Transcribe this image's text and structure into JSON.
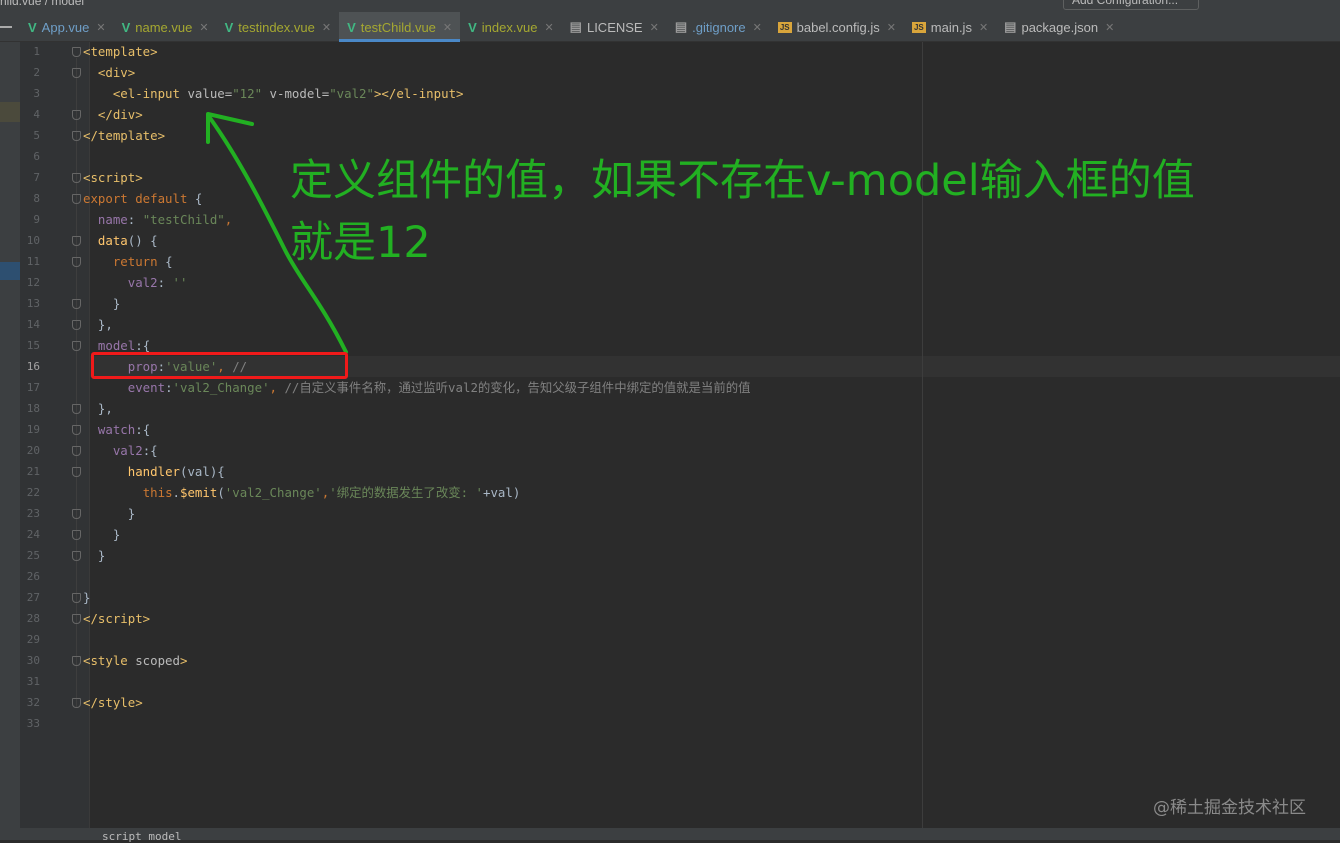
{
  "breadcrumb": "hild.vue / model",
  "run_config": "Add Configuration...",
  "tabs": [
    {
      "label": "App.vue",
      "icon": "V",
      "color": "#6f9fc8",
      "iconColor": "#41b883"
    },
    {
      "label": "name.vue",
      "icon": "V",
      "color": "#a5a831",
      "iconColor": "#41b883"
    },
    {
      "label": "testindex.vue",
      "icon": "V",
      "color": "#a5a831",
      "iconColor": "#41b883"
    },
    {
      "label": "testChild.vue",
      "icon": "V",
      "color": "#a5a831",
      "iconColor": "#41b883",
      "active": true
    },
    {
      "label": "index.vue",
      "icon": "V",
      "color": "#a5a831",
      "iconColor": "#41b883"
    },
    {
      "label": "LICENSE",
      "icon": "▤",
      "color": "#bbbbbb",
      "iconColor": "#999999"
    },
    {
      "label": ".gitignore",
      "icon": "▤",
      "color": "#6f9fc8",
      "iconColor": "#999999"
    },
    {
      "label": "babel.config.js",
      "icon": "JS",
      "color": "#bbbbbb",
      "iconColor": "#d9a53b"
    },
    {
      "label": "main.js",
      "icon": "JS",
      "color": "#bbbbbb",
      "iconColor": "#d9a53b"
    },
    {
      "label": "package.json",
      "icon": "▤",
      "color": "#bbbbbb",
      "iconColor": "#999999"
    }
  ],
  "current_line": 16,
  "code": [
    [
      [
        "<template>",
        "tag"
      ]
    ],
    [
      [
        "  "
      ],
      [
        "<div>",
        "tag"
      ]
    ],
    [
      [
        "    "
      ],
      [
        "<el-input ",
        "tag"
      ],
      [
        "value=",
        "attr"
      ],
      [
        "\"12\"",
        "str"
      ],
      [
        " v-model=",
        "attr"
      ],
      [
        "\"val2\"",
        "str"
      ],
      [
        "></el-input>",
        "tag"
      ]
    ],
    [
      [
        "  "
      ],
      [
        "</div>",
        "tag"
      ]
    ],
    [
      [
        "</template>",
        "tag"
      ]
    ],
    [],
    [
      [
        "<script>",
        "tag"
      ]
    ],
    [
      [
        "export default ",
        "kw"
      ],
      [
        "{"
      ]
    ],
    [
      [
        "  "
      ],
      [
        "name",
        "prop"
      ],
      [
        ": "
      ],
      [
        "\"testChild\"",
        "str"
      ],
      [
        ",",
        "kw"
      ]
    ],
    [
      [
        "  "
      ],
      [
        "data",
        "fn"
      ],
      [
        "() {"
      ]
    ],
    [
      [
        "    "
      ],
      [
        "return ",
        "kw"
      ],
      [
        "{"
      ]
    ],
    [
      [
        "      "
      ],
      [
        "val2",
        "prop"
      ],
      [
        ": "
      ],
      [
        "''",
        "str"
      ]
    ],
    [
      [
        "    }"
      ]
    ],
    [
      [
        "  },"
      ]
    ],
    [
      [
        "  "
      ],
      [
        "model",
        "prop"
      ],
      [
        ":{"
      ]
    ],
    [
      [
        "      "
      ],
      [
        "prop",
        "prop"
      ],
      [
        ":"
      ],
      [
        "'value'",
        "str"
      ],
      [
        ", ",
        "kw"
      ],
      [
        "//",
        "cm"
      ]
    ],
    [
      [
        "      "
      ],
      [
        "event",
        "prop"
      ],
      [
        ":"
      ],
      [
        "'val2_Change'",
        "str"
      ],
      [
        ", ",
        "kw"
      ],
      [
        "//自定义事件名称，通过监听val2的变化，告知父级子组件中绑定的值就是当前的值",
        "cm"
      ]
    ],
    [
      [
        "  },"
      ]
    ],
    [
      [
        "  "
      ],
      [
        "watch",
        "prop"
      ],
      [
        ":{"
      ]
    ],
    [
      [
        "    "
      ],
      [
        "val2",
        "prop"
      ],
      [
        ":{"
      ]
    ],
    [
      [
        "      "
      ],
      [
        "handler",
        "fn"
      ],
      [
        "(val){"
      ]
    ],
    [
      [
        "        "
      ],
      [
        "this",
        "kw"
      ],
      [
        "."
      ],
      [
        "$emit",
        "fn"
      ],
      [
        "("
      ],
      [
        "'val2_Change'",
        "str"
      ],
      [
        ",",
        "kw"
      ],
      [
        "'绑定的数据发生了改变: '",
        "str"
      ],
      [
        "+val)"
      ]
    ],
    [
      [
        "      }"
      ]
    ],
    [
      [
        "    }"
      ]
    ],
    [
      [
        "  }"
      ]
    ],
    [],
    [
      [
        "}"
      ]
    ],
    [
      [
        "</script>",
        "tag"
      ]
    ],
    [],
    [
      [
        "<style ",
        "tag"
      ],
      [
        "scoped",
        "attr"
      ],
      [
        ">",
        "tag"
      ]
    ],
    [],
    [
      [
        "</style>",
        "tag"
      ]
    ],
    []
  ],
  "folds": [
    1,
    2,
    4,
    5,
    7,
    8,
    10,
    11,
    13,
    14,
    15,
    18,
    19,
    20,
    21,
    23,
    24,
    25,
    27,
    28,
    30,
    32
  ],
  "annotation": {
    "line1": "定义组件的值，如果不存在v-model输入框的值",
    "line2": "就是12",
    "color": "#22b022"
  },
  "bottom_text": "script model",
  "watermark": "@稀土掘金技术社区"
}
